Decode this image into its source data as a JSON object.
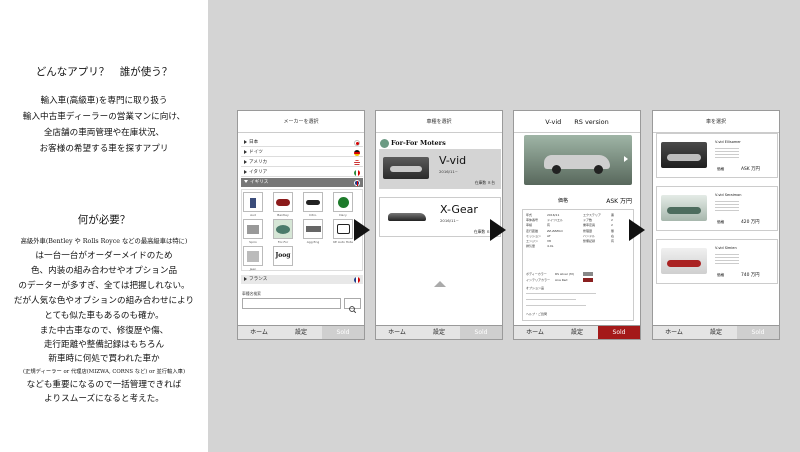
{
  "left": {
    "heading1": "どんなアプリ？　誰が使う？",
    "intro": [
      "輸入車(高級車)を専門に取り扱う",
      "輸入中古車ディーラーの営業マンに向け、",
      "全店舗の車両管理や在庫状況、",
      "お客様の希望する車を探すアプリ"
    ],
    "heading2": "何が必要？",
    "body": [
      "高級外車(Bentley や Rolls Royce などの最高級車は特に)",
      "は一台一台がオーダーメイドのため",
      "色、内装の組み合わせやオプション品",
      "のデーターが多すぎ、全ては把握しれない。",
      "だが人気な色やオプションの組み合わせにより",
      "とても似た車もあるのも確か。",
      "また中古車なので、修復歴や傷、",
      "走行距離や整備記録はもちろん",
      "新車時に何処で買われた車か",
      "(正規ディーラー or 代理店(MIZWA, CORNS など) or 並行輸入車)",
      "なども重要になるので一括管理できれば",
      "よりスムーズになると考えた。"
    ]
  },
  "tabs": {
    "home": "ホーム",
    "settings": "設定",
    "sold": "Sold"
  },
  "screen1": {
    "title": "メーカーを選択",
    "countries": [
      "日本",
      "ドイツ",
      "アメリカ",
      "イタリア",
      "イギリス"
    ],
    "flag_colors": [
      "#d40000",
      "#444444",
      "#3455a8",
      "#2a8a3a",
      "#1e3b8a"
    ],
    "logos": [
      "Audi",
      "Bentley",
      "Citroen",
      "Dacia",
      "Lotus",
      "Morgan",
      "Aston",
      "Rolls",
      "Jaguar",
      "Bristol",
      "Jeep",
      "Jaguar"
    ],
    "logo_caption_row1": [
      "Aud",
      "Bentley",
      "Citro.",
      "Dacy"
    ],
    "logo_caption_row2": [
      "Spiro",
      "For-For",
      "Agg Eng",
      "KE Auto Hote"
    ],
    "logo_caption_row3": [
      "Jeen"
    ],
    "extra_logo": "Joog",
    "france": "フランス",
    "search_label": "車種名検索"
  },
  "screen2": {
    "title": "車種を選択",
    "maker": "For-For Moters",
    "items": [
      {
        "name": "V-vid",
        "date": "2016/11~",
        "stock": "在庫数 ８台"
      },
      {
        "name": "X-Gear",
        "date": "2016/11~",
        "stock": "在庫数 ６台"
      }
    ]
  },
  "screen3": {
    "title": "V-vid　　RS version",
    "price_label": "価格",
    "price_value": "ASK 万円",
    "spec_left_labels": [
      "年式",
      "車体番号",
      "車検",
      "走行距離",
      "ミッション",
      "エンジン",
      "排気量"
    ],
    "spec_left_values": [
      "2016/11",
      "ドイツ/エル",
      "有",
      "ZZ,ZZZKm",
      "AT",
      "V8",
      "4.0L"
    ],
    "spec_right_labels": [
      "エクステリア",
      "ドア数",
      "乗車定員",
      "修理歴",
      "ハンドル",
      "整備記録"
    ],
    "spec_right_values": [
      "黒",
      "2",
      "2",
      "無",
      "右",
      "有"
    ],
    "color_ext_label": "ボディーカラー",
    "color_ext_value": "RS silver (M)",
    "color_int_label": "インテリアカラー",
    "color_int_value": "Ana Red",
    "options_label": "オプション品",
    "footer_note": "ヘルプ・ご質問"
  },
  "screen4": {
    "title": "車を選択",
    "cars": [
      {
        "name": "V-vid Ellisomer",
        "price_label": "価格",
        "price": "ASK 万円"
      },
      {
        "name": "V-vid Seraimon",
        "price_label": "価格",
        "price": "420 万円"
      },
      {
        "name": "V-vid Simien",
        "price_label": "価格",
        "price": "740 万円"
      }
    ]
  },
  "colors": {
    "sold_red": "#a41919",
    "panel_gray": "#d4d4d4",
    "card_gray": "#d9d9d9"
  }
}
